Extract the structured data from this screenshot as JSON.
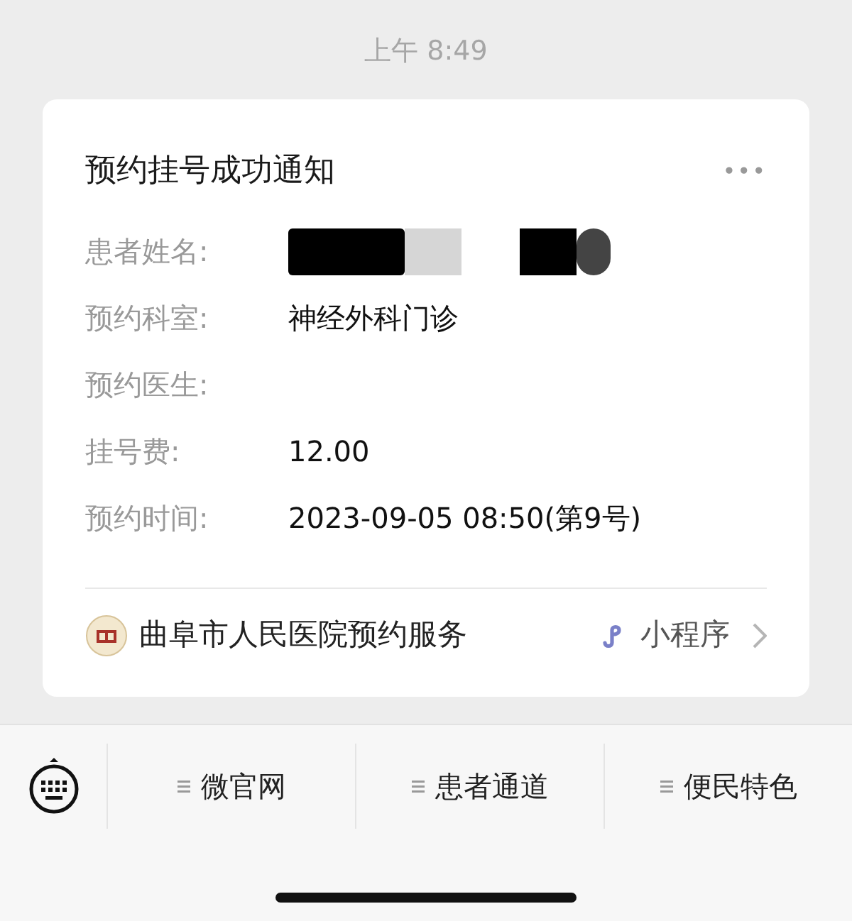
{
  "time": "上午 8:49",
  "card": {
    "title": "预约挂号成功通知",
    "more": "•••",
    "fields": [
      {
        "label": "患者姓名:",
        "kind": "redacted"
      },
      {
        "label": "预约科室:",
        "value": "神经外科门诊",
        "kind": "text"
      },
      {
        "label": "预约医生:",
        "kind": "blank"
      },
      {
        "label": "挂号费:",
        "value": "12.00",
        "kind": "text"
      },
      {
        "label": "预约时间:",
        "value": "2023-09-05 08:50(第9号)",
        "kind": "text"
      }
    ],
    "source": {
      "name": "曲阜市人民医院预约服务",
      "type": "小程序"
    }
  },
  "menu": [
    {
      "label": "微官网"
    },
    {
      "label": "患者通道"
    },
    {
      "label": "便民特色"
    }
  ]
}
